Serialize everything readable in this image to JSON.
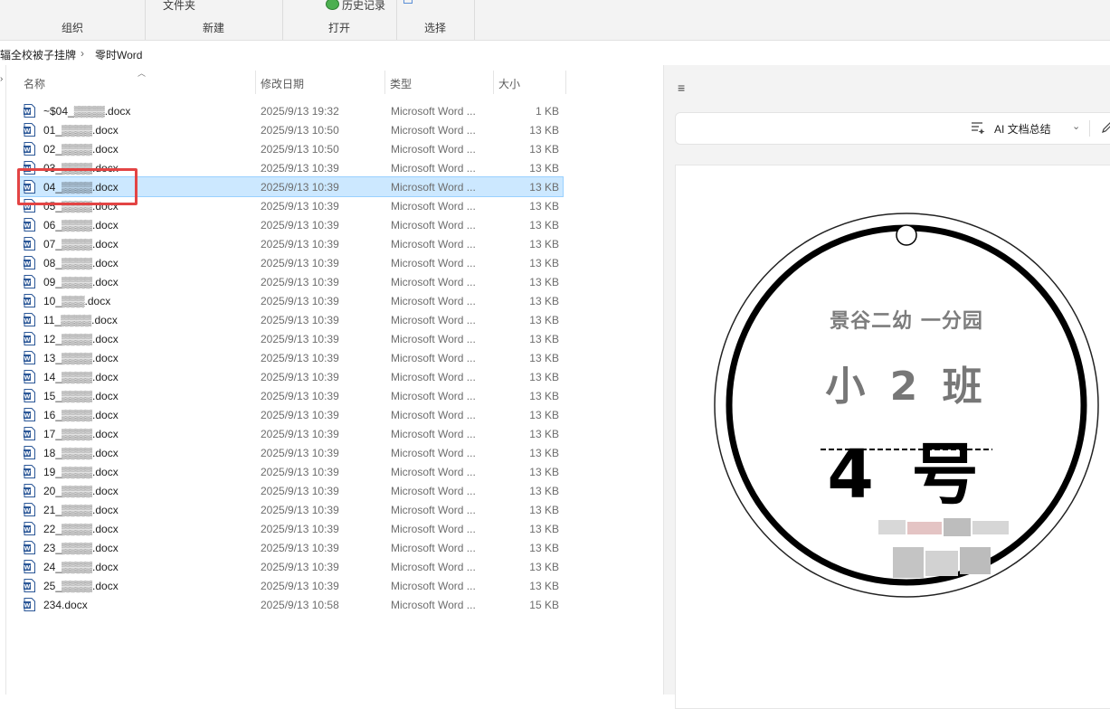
{
  "ribbon": {
    "groups": [
      {
        "label": "组织",
        "top": ""
      },
      {
        "label": "新建",
        "top": "文件夹"
      },
      {
        "label": "打开",
        "top": "历史记录"
      },
      {
        "label": "选择",
        "top": ""
      }
    ]
  },
  "address": {
    "parent": "辐全校被子挂牌",
    "separator": "›",
    "current": "零时Word"
  },
  "columns": {
    "name": "名称",
    "date": "修改日期",
    "type": "类型",
    "size": "大小"
  },
  "files": [
    {
      "name": "~$04_▒▒▒▒.docx",
      "date": "2025/9/13 19:32",
      "type": "Microsoft Word ...",
      "size": "1 KB"
    },
    {
      "name": "01_▒▒▒▒.docx",
      "date": "2025/9/13 10:50",
      "type": "Microsoft Word ...",
      "size": "13 KB"
    },
    {
      "name": "02_▒▒▒▒.docx",
      "date": "2025/9/13 10:50",
      "type": "Microsoft Word ...",
      "size": "13 KB"
    },
    {
      "name": "03_▒▒▒▒.docx",
      "date": "2025/9/13 10:39",
      "type": "Microsoft Word ...",
      "size": "13 KB"
    },
    {
      "name": "04_▒▒▒▒.docx",
      "date": "2025/9/13 10:39",
      "type": "Microsoft Word ...",
      "size": "13 KB",
      "selected": true
    },
    {
      "name": "05_▒▒▒▒.docx",
      "date": "2025/9/13 10:39",
      "type": "Microsoft Word ...",
      "size": "13 KB"
    },
    {
      "name": "06_▒▒▒▒.docx",
      "date": "2025/9/13 10:39",
      "type": "Microsoft Word ...",
      "size": "13 KB"
    },
    {
      "name": "07_▒▒▒▒.docx",
      "date": "2025/9/13 10:39",
      "type": "Microsoft Word ...",
      "size": "13 KB"
    },
    {
      "name": "08_▒▒▒▒.docx",
      "date": "2025/9/13 10:39",
      "type": "Microsoft Word ...",
      "size": "13 KB"
    },
    {
      "name": "09_▒▒▒▒.docx",
      "date": "2025/9/13 10:39",
      "type": "Microsoft Word ...",
      "size": "13 KB"
    },
    {
      "name": "10_▒▒▒.docx",
      "date": "2025/9/13 10:39",
      "type": "Microsoft Word ...",
      "size": "13 KB"
    },
    {
      "name": "11_▒▒▒▒.docx",
      "date": "2025/9/13 10:39",
      "type": "Microsoft Word ...",
      "size": "13 KB"
    },
    {
      "name": "12_▒▒▒▒.docx",
      "date": "2025/9/13 10:39",
      "type": "Microsoft Word ...",
      "size": "13 KB"
    },
    {
      "name": "13_▒▒▒▒.docx",
      "date": "2025/9/13 10:39",
      "type": "Microsoft Word ...",
      "size": "13 KB"
    },
    {
      "name": "14_▒▒▒▒.docx",
      "date": "2025/9/13 10:39",
      "type": "Microsoft Word ...",
      "size": "13 KB"
    },
    {
      "name": "15_▒▒▒▒.docx",
      "date": "2025/9/13 10:39",
      "type": "Microsoft Word ...",
      "size": "13 KB"
    },
    {
      "name": "16_▒▒▒▒.docx",
      "date": "2025/9/13 10:39",
      "type": "Microsoft Word ...",
      "size": "13 KB"
    },
    {
      "name": "17_▒▒▒▒.docx",
      "date": "2025/9/13 10:39",
      "type": "Microsoft Word ...",
      "size": "13 KB"
    },
    {
      "name": "18_▒▒▒▒.docx",
      "date": "2025/9/13 10:39",
      "type": "Microsoft Word ...",
      "size": "13 KB"
    },
    {
      "name": "19_▒▒▒▒.docx",
      "date": "2025/9/13 10:39",
      "type": "Microsoft Word ...",
      "size": "13 KB"
    },
    {
      "name": "20_▒▒▒▒.docx",
      "date": "2025/9/13 10:39",
      "type": "Microsoft Word ...",
      "size": "13 KB"
    },
    {
      "name": "21_▒▒▒▒.docx",
      "date": "2025/9/13 10:39",
      "type": "Microsoft Word ...",
      "size": "13 KB"
    },
    {
      "name": "22_▒▒▒▒.docx",
      "date": "2025/9/13 10:39",
      "type": "Microsoft Word ...",
      "size": "13 KB"
    },
    {
      "name": "23_▒▒▒▒.docx",
      "date": "2025/9/13 10:39",
      "type": "Microsoft Word ...",
      "size": "13 KB"
    },
    {
      "name": "24_▒▒▒▒.docx",
      "date": "2025/9/13 10:39",
      "type": "Microsoft Word ...",
      "size": "13 KB"
    },
    {
      "name": "25_▒▒▒▒.docx",
      "date": "2025/9/13 10:39",
      "type": "Microsoft Word ...",
      "size": "13 KB"
    },
    {
      "name": "234.docx",
      "date": "2025/9/13 10:58",
      "type": "Microsoft Word ...",
      "size": "15 KB"
    }
  ],
  "preview": {
    "menu_icon": "≡",
    "ai_label": "AI 文档总结",
    "tag": {
      "school": "景谷二幼  一分园",
      "class_name": "小 2 班",
      "number": "4 号"
    }
  },
  "colors": {
    "selection_bg": "#cce8ff",
    "highlight_box": "#e34444",
    "word_blue": "#2b5797"
  },
  "icons": {
    "file": "word-doc-icon",
    "history": "history-icon",
    "ai": "ai-summary-icon",
    "edit": "pen-icon"
  }
}
